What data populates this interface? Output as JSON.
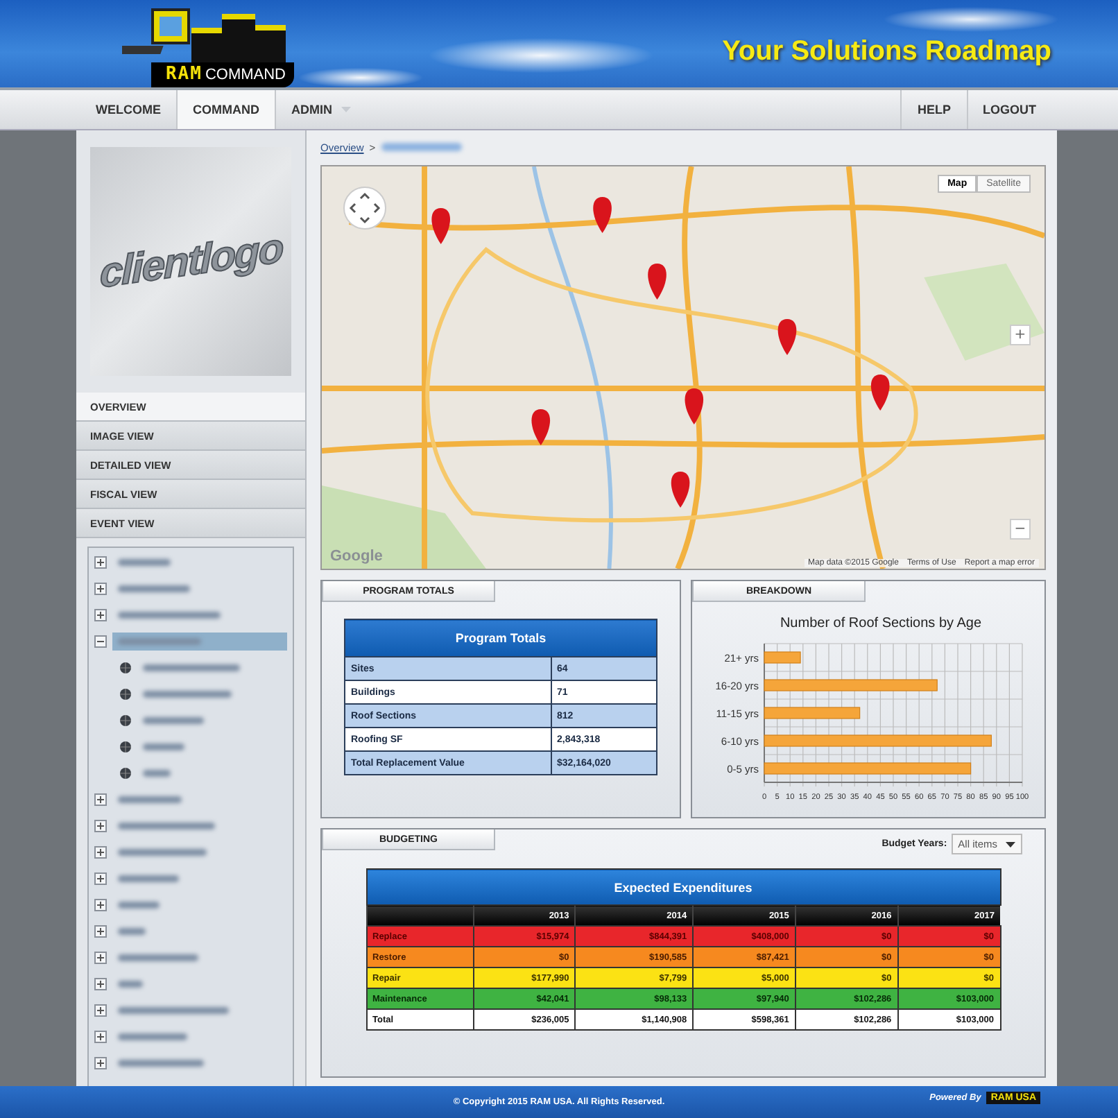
{
  "header": {
    "logo_part_1": "RAM",
    "logo_part_2": "COMMAND",
    "title": "Your Solutions Roadmap"
  },
  "nav": {
    "left": [
      {
        "label": "WELCOME",
        "selected": false,
        "dropdown": false
      },
      {
        "label": "COMMAND",
        "selected": true,
        "dropdown": false
      },
      {
        "label": "ADMIN",
        "selected": false,
        "dropdown": true
      }
    ],
    "right": [
      {
        "label": "HELP"
      },
      {
        "label": "LOGOUT"
      }
    ]
  },
  "sidebar": {
    "client_logo": "clientlogo",
    "views": [
      {
        "label": "OVERVIEW",
        "selected": true
      },
      {
        "label": "IMAGE VIEW",
        "selected": false
      },
      {
        "label": "DETAILED VIEW",
        "selected": false
      },
      {
        "label": "FISCAL VIEW",
        "selected": false
      },
      {
        "label": "EVENT VIEW",
        "selected": false
      }
    ],
    "tree": [
      {
        "expanded": false,
        "selected": false
      },
      {
        "expanded": false,
        "selected": false
      },
      {
        "expanded": false,
        "selected": false
      },
      {
        "expanded": true,
        "selected": true,
        "children": [
          {
            "selected": false
          },
          {
            "selected": false
          },
          {
            "selected": false
          },
          {
            "selected": false
          },
          {
            "selected": false
          }
        ]
      },
      {
        "expanded": false,
        "selected": false
      },
      {
        "expanded": false,
        "selected": false
      },
      {
        "expanded": false,
        "selected": false
      },
      {
        "expanded": false,
        "selected": false
      },
      {
        "expanded": false,
        "selected": false
      },
      {
        "expanded": false,
        "selected": false
      },
      {
        "expanded": false,
        "selected": false
      },
      {
        "expanded": false,
        "selected": false
      },
      {
        "expanded": false,
        "selected": false
      },
      {
        "expanded": false,
        "selected": false
      },
      {
        "expanded": false,
        "selected": false
      }
    ]
  },
  "breadcrumb": {
    "link": "Overview",
    "separator": ">"
  },
  "map": {
    "kind": "picture",
    "type_buttons": [
      {
        "label": "Map",
        "selected": true
      },
      {
        "label": "Satellite",
        "selected": false
      }
    ],
    "zoom_in": "+",
    "zoom_out": "−",
    "logo": "Google",
    "attribution": "Map data ©2015 Google",
    "terms": "Terms of Use",
    "report": "Report a map error"
  },
  "program_totals": {
    "tab": "PROGRAM TOTALS",
    "title": "Program Totals",
    "rows": [
      {
        "label": "Sites",
        "value": "64"
      },
      {
        "label": "Buildings",
        "value": "71"
      },
      {
        "label": "Roof Sections",
        "value": "812"
      },
      {
        "label": "Roofing SF",
        "value": "2,843,318"
      },
      {
        "label": "Total Replacement Value",
        "value": "$32,164,020"
      }
    ]
  },
  "breakdown": {
    "tab": "BREAKDOWN",
    "chart_data": {
      "type": "bar",
      "orientation": "horizontal",
      "title": "Number of Roof Sections by Age",
      "categories": [
        "21+ yrs",
        "16-20 yrs",
        "11-15 yrs",
        "6-10 yrs",
        "0-5 yrs"
      ],
      "values": [
        14,
        67,
        37,
        88,
        80
      ],
      "grid": true,
      "xlim": [
        0,
        100
      ],
      "xticks": [
        0,
        5,
        10,
        15,
        20,
        25,
        30,
        35,
        40,
        45,
        50,
        55,
        60,
        65,
        70,
        75,
        80,
        85,
        90,
        95,
        100
      ]
    }
  },
  "budgeting": {
    "tab": "BUDGETING",
    "filter_label": "Budget Years:",
    "filter_value": "All items",
    "title": "Expected Expenditures",
    "years": [
      "2013",
      "2014",
      "2015",
      "2016",
      "2017"
    ],
    "rows": [
      {
        "kind": "replace",
        "label": "Replace",
        "values": [
          "$15,974",
          "$844,391",
          "$408,000",
          "$0",
          "$0"
        ]
      },
      {
        "kind": "restore",
        "label": "Restore",
        "values": [
          "$0",
          "$190,585",
          "$87,421",
          "$0",
          "$0"
        ]
      },
      {
        "kind": "repair",
        "label": "Repair",
        "values": [
          "$177,990",
          "$7,799",
          "$5,000",
          "$0",
          "$0"
        ]
      },
      {
        "kind": "maintenance",
        "label": "Maintenance",
        "values": [
          "$42,041",
          "$98,133",
          "$97,940",
          "$102,286",
          "$103,000"
        ]
      },
      {
        "kind": "total",
        "label": "Total",
        "values": [
          "$236,005",
          "$1,140,908",
          "$598,361",
          "$102,286",
          "$103,000"
        ]
      }
    ]
  },
  "footer": {
    "copyright": "© Copyright 2015 RAM USA. All Rights Reserved.",
    "powered_by": "Powered By",
    "powered_logo": "RAM USA"
  }
}
